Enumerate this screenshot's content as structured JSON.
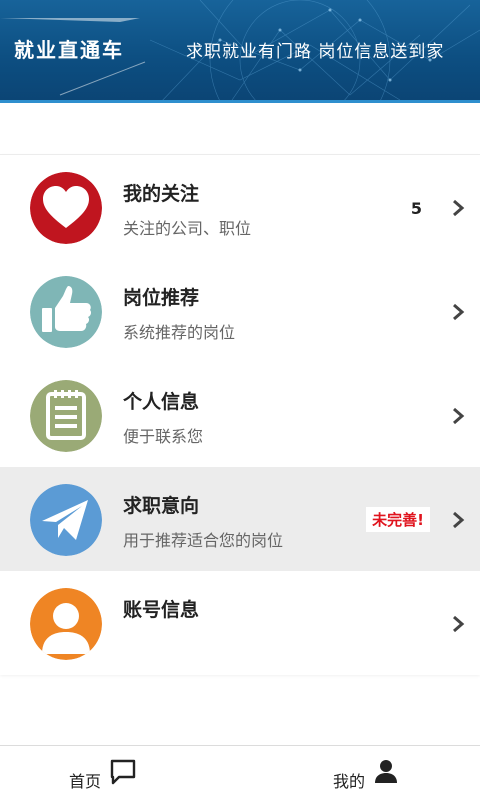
{
  "banner": {
    "title": "就业直通车",
    "slogan": "求职就业有门路  岗位信息送到家"
  },
  "menu": {
    "items": [
      {
        "title": "我的关注",
        "subtitle": "关注的公司、职位",
        "count": "5",
        "icon": "heart-icon",
        "color": "#c0151f"
      },
      {
        "title": "岗位推荐",
        "subtitle": "系统推荐的岗位",
        "icon": "thumbs-up-icon",
        "color": "#7fb6b6"
      },
      {
        "title": "个人信息",
        "subtitle": "便于联系您",
        "icon": "notepad-icon",
        "color": "#9aaa76"
      },
      {
        "title": "求职意向",
        "subtitle": "用于推荐适合您的岗位",
        "badge": "未完善!",
        "icon": "paper-plane-icon",
        "color": "#5b9bd5"
      },
      {
        "title": "账号信息",
        "subtitle": "",
        "icon": "user-icon",
        "color": "#ef8524"
      }
    ]
  },
  "bottom_nav": {
    "home_label": "首页",
    "mine_label": "我的"
  },
  "colors": {
    "banner": "#0d4f82",
    "badge_text": "#e0141e",
    "active_row": "#ececec"
  }
}
